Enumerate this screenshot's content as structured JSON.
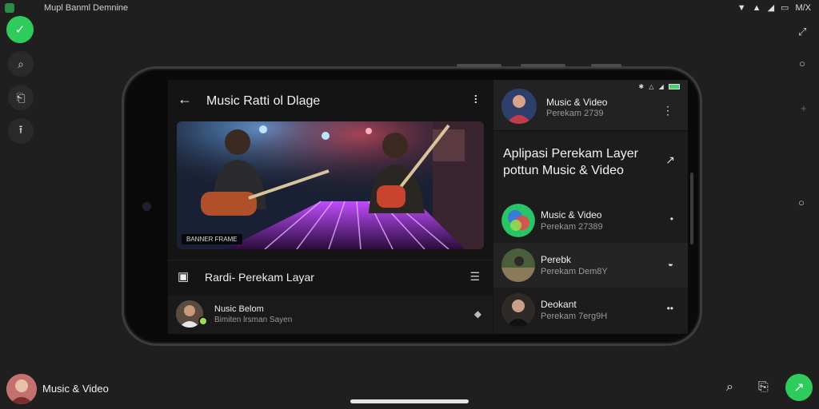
{
  "os_status": {
    "title": "Mupl Banml Demnine",
    "icons": [
      "wifi-icon",
      "signal-icon",
      "signal-bars-icon",
      "battery-icon"
    ],
    "time_label": "M/X"
  },
  "rail": {
    "fab_icon": "download-check-icon",
    "buttons": [
      "search-feedback-icon",
      "document-icon",
      "upload-icon"
    ]
  },
  "phone": {
    "left": {
      "title": "Music Ratti ol Dlage",
      "video_badge": "BANNER FRAME",
      "section_title": "Rardi- Perekam Layar",
      "row": {
        "name": "Nusic Belom",
        "sub": "Bimiten lrsman Sayen"
      }
    },
    "right": {
      "status_icons": "✱ △ ◢",
      "header": {
        "name": "Music & Video",
        "sub": "Perekam 2739"
      },
      "promo_text": "Aplipasi Perekam Layer pottun Music & Video",
      "rows": [
        {
          "name": "Music & Video",
          "sub": "Perekam 27389",
          "act": "•",
          "avatar_color": "#3a7bd5"
        },
        {
          "name": "Perebk",
          "sub": "Perekam Dem8Y",
          "act": "◒",
          "avatar_color": "#4a5e3a"
        },
        {
          "name": "Deokant",
          "sub": "Perekam 7erg9H",
          "act": "••",
          "avatar_color": "#2e2a26"
        }
      ]
    }
  },
  "bottom": {
    "label": "Music & Video",
    "icons": [
      "search-icon",
      "share-icon"
    ]
  },
  "colors": {
    "accent_green": "#2ecc5b",
    "background": "#1f1f1f"
  }
}
